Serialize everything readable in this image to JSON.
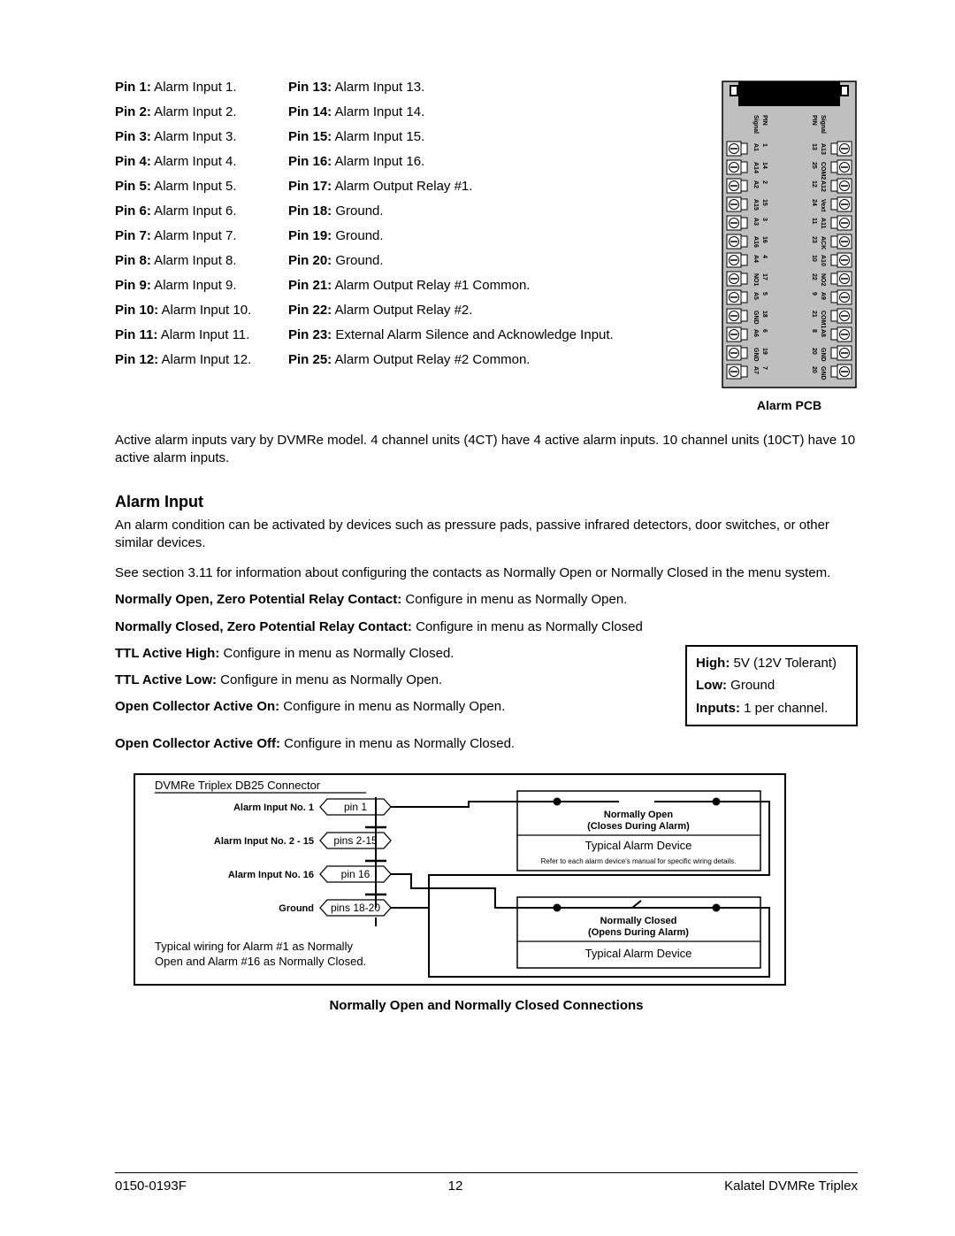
{
  "pins_col1": [
    {
      "label": "Pin 1:",
      "desc": "Alarm Input 1."
    },
    {
      "label": "Pin 2:",
      "desc": "Alarm Input 2."
    },
    {
      "label": "Pin 3:",
      "desc": "Alarm Input 3."
    },
    {
      "label": "Pin 4:",
      "desc": "Alarm Input 4."
    },
    {
      "label": "Pin 5:",
      "desc": "Alarm Input 5."
    },
    {
      "label": "Pin 6:",
      "desc": "Alarm Input 6."
    },
    {
      "label": "Pin 7:",
      "desc": "Alarm Input 7."
    },
    {
      "label": "Pin 8:",
      "desc": "Alarm Input 8."
    },
    {
      "label": "Pin 9:",
      "desc": "Alarm Input 9."
    },
    {
      "label": "Pin 10:",
      "desc": "Alarm Input 10."
    },
    {
      "label": "Pin 11:",
      "desc": "Alarm Input 11."
    },
    {
      "label": "Pin 12:",
      "desc": "Alarm Input 12."
    }
  ],
  "pins_col2": [
    {
      "label": "Pin 13:",
      "desc": "Alarm Input 13."
    },
    {
      "label": "Pin 14:",
      "desc": "Alarm Input 14."
    },
    {
      "label": "Pin 15:",
      "desc": "Alarm Input 15."
    },
    {
      "label": "Pin 16:",
      "desc": "Alarm Input 16."
    },
    {
      "label": "Pin 17:",
      "desc": "Alarm Output Relay #1."
    },
    {
      "label": "Pin 18:",
      "desc": "Ground."
    },
    {
      "label": "Pin 19:",
      "desc": "Ground."
    },
    {
      "label": "Pin 20:",
      "desc": "Ground."
    },
    {
      "label": "Pin 21:",
      "desc": "Alarm Output Relay #1 Common."
    },
    {
      "label": "Pin 22:",
      "desc": "Alarm Output Relay #2."
    },
    {
      "label": "Pin 23:",
      "desc": "External Alarm Silence and Acknowledge Input."
    },
    {
      "label": "Pin 25:",
      "desc": "Alarm Output Relay #2 Common."
    }
  ],
  "pcb_caption": "Alarm PCB",
  "pcb_left_header": {
    "sig": "Signal",
    "pin": "PIN"
  },
  "pcb_right_header": {
    "pin": "PIN",
    "sig": "Signal"
  },
  "pcb_left": [
    {
      "sig": "A1",
      "pin": "1"
    },
    {
      "sig": "A14",
      "pin": "14"
    },
    {
      "sig": "A2",
      "pin": "2"
    },
    {
      "sig": "A15",
      "pin": "15"
    },
    {
      "sig": "A3",
      "pin": "3"
    },
    {
      "sig": "A16",
      "pin": "16"
    },
    {
      "sig": "A4",
      "pin": "4"
    },
    {
      "sig": "NO1",
      "pin": "17"
    },
    {
      "sig": "A5",
      "pin": "5"
    },
    {
      "sig": "GND",
      "pin": "18"
    },
    {
      "sig": "A6",
      "pin": "6"
    },
    {
      "sig": "GND",
      "pin": "19"
    },
    {
      "sig": "A7",
      "pin": "7"
    }
  ],
  "pcb_right": [
    {
      "pin": "13",
      "sig": "A13"
    },
    {
      "pin": "25",
      "sig": "COM2"
    },
    {
      "pin": "12",
      "sig": "A12"
    },
    {
      "pin": "24",
      "sig": "Vext"
    },
    {
      "pin": "11",
      "sig": "A11"
    },
    {
      "pin": "23",
      "sig": "ACK"
    },
    {
      "pin": "10",
      "sig": "A10"
    },
    {
      "pin": "22",
      "sig": "NO2"
    },
    {
      "pin": "9",
      "sig": "A9"
    },
    {
      "pin": "21",
      "sig": "COM1"
    },
    {
      "pin": "8",
      "sig": "A8"
    },
    {
      "pin": "20",
      "sig": "GND"
    },
    {
      "pin": "20",
      "sig": "GND"
    }
  ],
  "active_alarm_para": "Active alarm inputs vary by DVMRe model. 4 channel units (4CT) have 4 active alarm inputs. 10 channel units (10CT) have 10 active alarm inputs.",
  "alarm_input_heading": "Alarm Input",
  "alarm_input_para1": "An alarm condition can be activated by devices such as pressure pads, passive infrared detectors, door switches, or other similar devices.",
  "alarm_input_para2": "See section 3.11 for information about configuring the contacts as Normally Open or Normally Closed in the menu system.",
  "config_lines": [
    {
      "bold": "Normally Open, Zero Potential Relay Contact:",
      "rest": "  Configure in menu as Normally Open."
    },
    {
      "bold": "Normally Closed, Zero Potential Relay Contact:",
      "rest": "  Configure in menu as Normally Closed"
    }
  ],
  "ttl_lines": [
    {
      "bold": "TTL Active High:",
      "rest": "  Configure in menu as Normally Closed."
    },
    {
      "bold": "TTL Active Low:",
      "rest": "  Configure in menu as Normally Open."
    },
    {
      "bold": "Open Collector Active On:",
      "rest": "  Configure in menu as Normally Open."
    }
  ],
  "open_collector_off": {
    "bold": "Open Collector Active Off:",
    "rest": "  Configure in menu as Normally Closed."
  },
  "spec_box": [
    {
      "bold": "High:",
      "rest": "  5V (12V Tolerant)"
    },
    {
      "bold": "Low:",
      "rest": "  Ground"
    },
    {
      "bold": "Inputs:",
      "rest": "  1 per channel."
    }
  ],
  "diagram": {
    "title": "DVMRe Triplex DB25 Connector",
    "rows": [
      {
        "left": "Alarm Input No. 1",
        "pin": "pin 1"
      },
      {
        "left": "Alarm Input No. 2 - 15",
        "pin": "pins 2-15"
      },
      {
        "left": "Alarm Input No. 16",
        "pin": "pin 16"
      },
      {
        "left": "Ground",
        "pin": "pins 18-20"
      }
    ],
    "note": "Typical wiring for Alarm #1 as Normally Open and Alarm #16 as Normally Closed.",
    "box_no": {
      "t1": "Normally Open",
      "t2": "(Closes During Alarm)",
      "t3": "Typical Alarm Device",
      "t4": "Refer to each alarm device's manual for specific wiring details."
    },
    "box_nc": {
      "t1": "Normally Closed",
      "t2": "(Opens During Alarm)",
      "t3": "Typical Alarm Device"
    }
  },
  "diagram_caption": "Normally Open and Normally Closed Connections",
  "footer": {
    "left": "0150-0193F",
    "center": "12",
    "right": "Kalatel DVMRe Triplex"
  }
}
